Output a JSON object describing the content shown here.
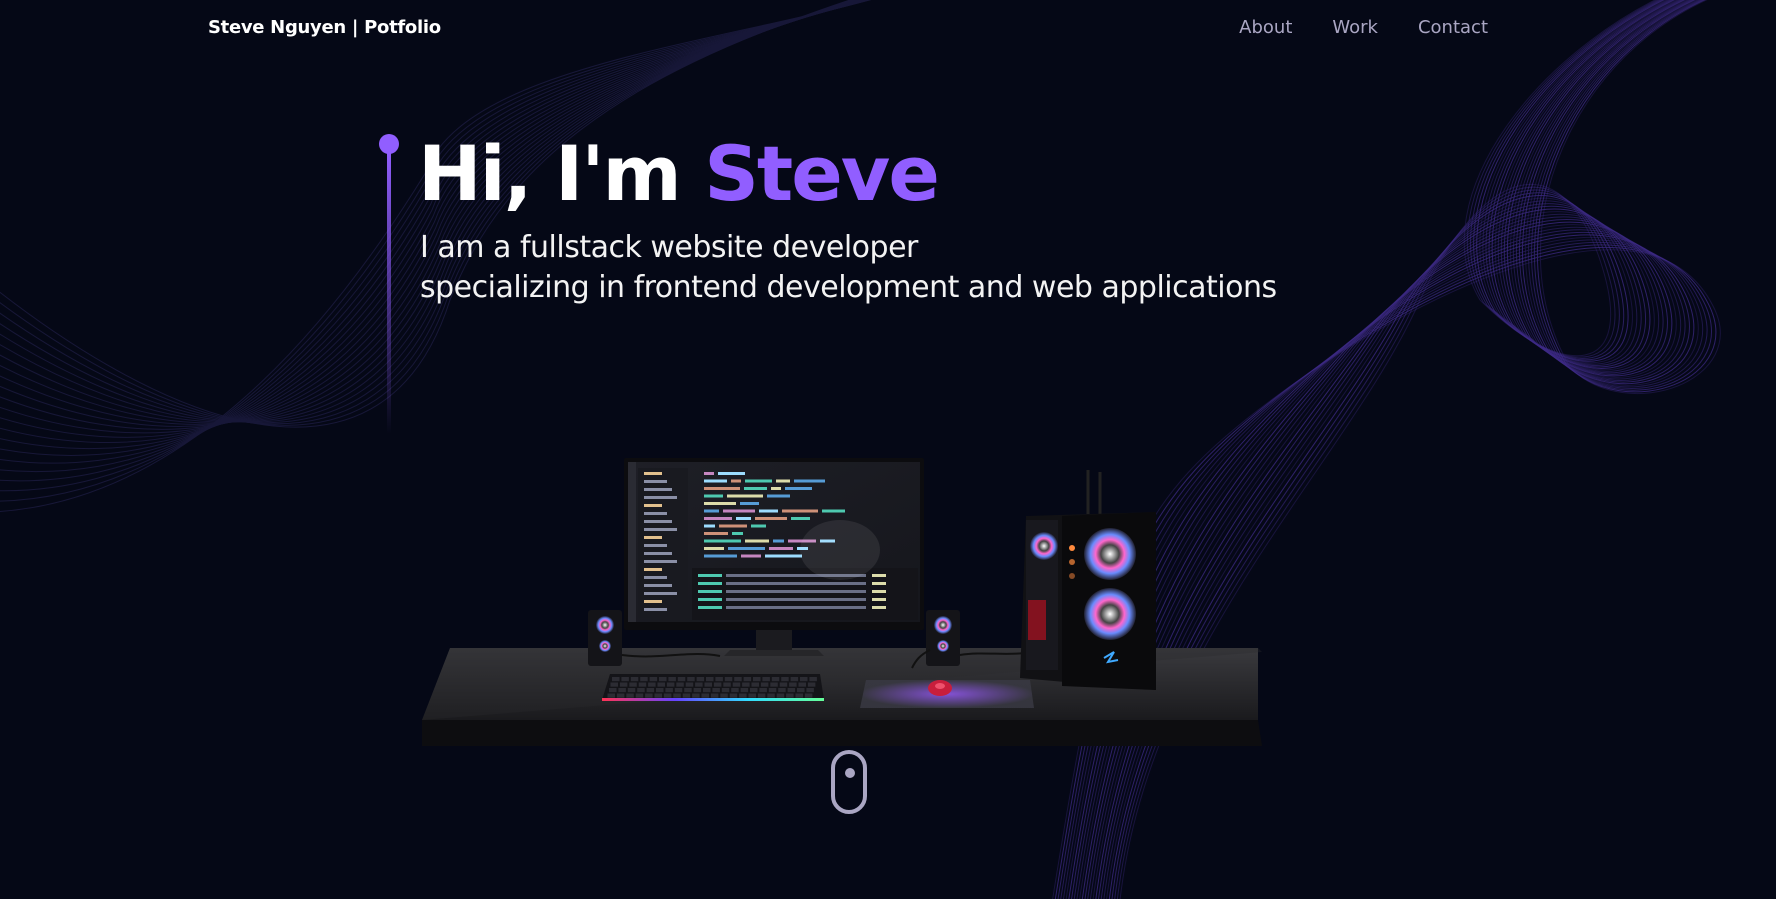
{
  "navbar": {
    "brand": "Steve Nguyen | Potfolio",
    "links": [
      "About",
      "Work",
      "Contact"
    ]
  },
  "hero": {
    "title_prefix": "Hi, I'm ",
    "title_name": "Steve",
    "subtitle_line1": "I am a fullstack website developer",
    "subtitle_line2": "specializing in frontend development and web applications"
  },
  "icons": {
    "scroll": "mouse-scroll-icon",
    "marker": "hero-marker-dot"
  },
  "colors": {
    "background": "#050816",
    "accent": "#915eff",
    "nav_text": "#aaa6c3",
    "text": "#ffffff"
  }
}
